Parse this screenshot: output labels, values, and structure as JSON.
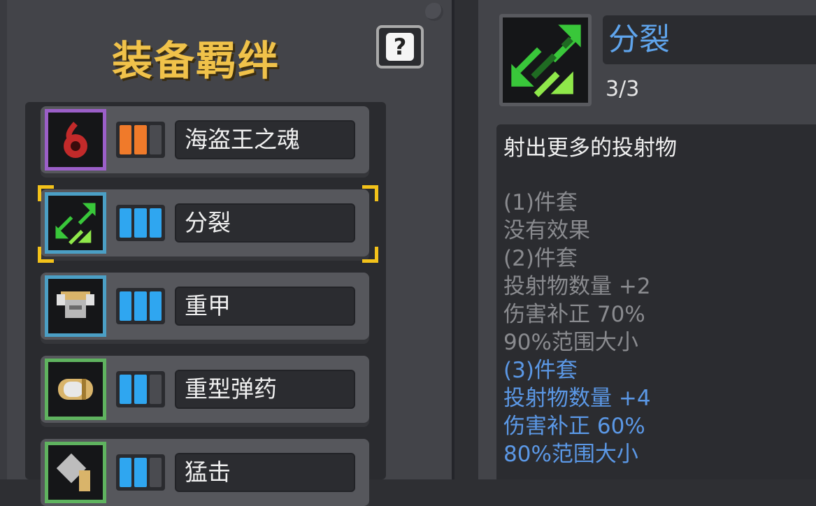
{
  "panel": {
    "title": "装备羁绊",
    "help_label": "?"
  },
  "bonds": [
    {
      "name": "海盗王之魂",
      "icon": "pirate-soul-icon",
      "frame_color": "#9b5fc8",
      "tier_color": "#f07a2a",
      "filled": 2,
      "total": 3
    },
    {
      "name": "分裂",
      "icon": "split-arrows-icon",
      "frame_color": "#4b9fc5",
      "tier_color": "#2fa6f0",
      "filled": 3,
      "total": 3,
      "selected": true
    },
    {
      "name": "重甲",
      "icon": "heavy-armor-icon",
      "frame_color": "#4b9fc5",
      "tier_color": "#2fa6f0",
      "filled": 3,
      "total": 3
    },
    {
      "name": "重型弹药",
      "icon": "heavy-ammo-icon",
      "frame_color": "#5fb35f",
      "tier_color": "#2fa6f0",
      "filled": 2,
      "total": 3
    },
    {
      "name": "猛击",
      "icon": "smash-icon",
      "frame_color": "#5fb35f",
      "tier_color": "#2fa6f0",
      "filled": 2,
      "total": 3
    }
  ],
  "detail": {
    "name": "分裂",
    "icon": "split-arrows-icon",
    "count": "3/3",
    "description": "射出更多的投射物",
    "lines": [
      {
        "text": "(1)件套",
        "state": "inactive"
      },
      {
        "text": "没有效果",
        "state": "inactive"
      },
      {
        "text": "(2)件套",
        "state": "inactive"
      },
      {
        "text": "投射物数量 +2",
        "state": "inactive"
      },
      {
        "text": "伤害补正 70%",
        "state": "inactive"
      },
      {
        "text": "90%范围大小",
        "state": "inactive"
      },
      {
        "text": "(3)件套",
        "state": "active"
      },
      {
        "text": "投射物数量 +4",
        "state": "active"
      },
      {
        "text": "伤害补正 60%",
        "state": "active"
      },
      {
        "text": "80%范围大小",
        "state": "active"
      }
    ]
  },
  "colors": {
    "title": "#f0c24a",
    "active_text": "#5b98e6",
    "inactive_text": "#8a8b8f",
    "selection": "#f3c21a"
  }
}
